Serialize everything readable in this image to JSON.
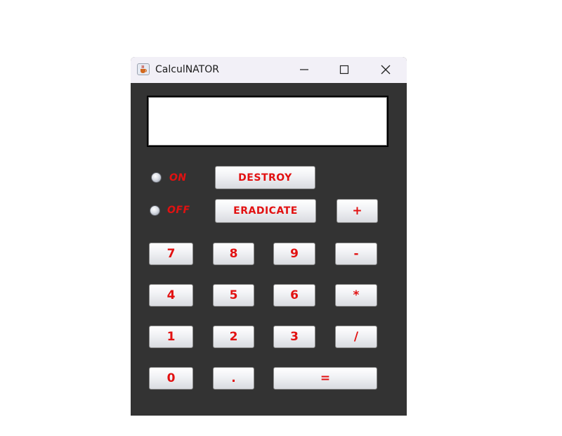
{
  "window": {
    "title": "CalculNATOR",
    "icon": "java-cup-icon",
    "controls": {
      "minimize": "minimize-icon",
      "maximize": "maximize-icon",
      "close": "close-icon"
    }
  },
  "display": {
    "value": ""
  },
  "power": {
    "on_label": "ON",
    "off_label": "OFF",
    "selected": "none"
  },
  "actions": {
    "destroy": "DESTROY",
    "eradicate": "ERADICATE"
  },
  "keys": {
    "plus": "+",
    "minus": "-",
    "multiply": "*",
    "divide": "/",
    "equals": "=",
    "dot": ".",
    "d0": "0",
    "d1": "1",
    "d2": "2",
    "d3": "3",
    "d4": "4",
    "d5": "5",
    "d6": "6",
    "d7": "7",
    "d8": "8",
    "d9": "9"
  },
  "colors": {
    "body": "#333333",
    "label_red": "#e21111",
    "titlebar": "#f2f0f7"
  }
}
